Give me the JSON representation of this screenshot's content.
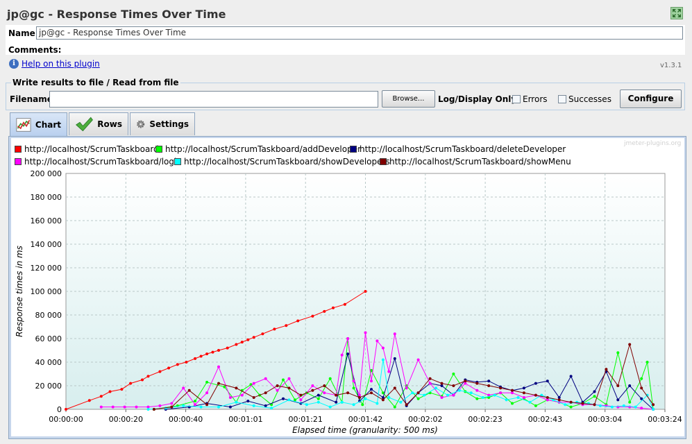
{
  "window": {
    "title": "jp@gc - Response Times Over Time"
  },
  "name": {
    "label": "Name:",
    "value": "jp@gc - Response Times Over Time"
  },
  "comments": {
    "label": "Comments:"
  },
  "help": {
    "link": "Help on this plugin",
    "version": "v1.3.1"
  },
  "file_group": {
    "title": "Write results to file / Read from file",
    "filename_label": "Filename",
    "filename_value": "",
    "browse": "Browse...",
    "log_display_label": "Log/Display Only:",
    "errors_label": "Errors",
    "errors_checked": false,
    "successes_label": "Successes",
    "successes_checked": false,
    "configure": "Configure"
  },
  "tabs": [
    {
      "label": "Chart",
      "icon": "chart-icon",
      "active": true
    },
    {
      "label": "Rows",
      "icon": "checkmark-icon",
      "active": false
    },
    {
      "label": "Settings",
      "icon": "gear-icon",
      "active": false
    }
  ],
  "watermark": "jmeter-plugins.org",
  "chart_data": {
    "type": "line",
    "xlabel": "Elapsed time (granularity: 500 ms)",
    "ylabel": "Response times in ms",
    "x_ticks": [
      "00:00:00",
      "00:00:20",
      "00:00:40",
      "00:01:01",
      "00:01:21",
      "00:01:42",
      "00:02:02",
      "00:02:23",
      "00:02:43",
      "00:03:04",
      "00:03:24"
    ],
    "y_ticks": [
      "0",
      "20 000",
      "40 000",
      "60 000",
      "80 000",
      "100 000",
      "120 000",
      "140 000",
      "160 000",
      "180 000",
      "200 000"
    ],
    "xlim_seconds": [
      0,
      204
    ],
    "ylim": [
      0,
      200000
    ],
    "grid": true,
    "legend_position": "top",
    "series": [
      {
        "name": "http://localhost/ScrumTaskboard/",
        "color": "#ff0000",
        "x": [
          0,
          8,
          12,
          15,
          19,
          22,
          26,
          28,
          32,
          35,
          38,
          41,
          44,
          46,
          48,
          50,
          52,
          55,
          58,
          60,
          62,
          64,
          67,
          71,
          75,
          79,
          84,
          88,
          91,
          95,
          102
        ],
        "y": [
          0,
          7500,
          11000,
          15000,
          17000,
          22000,
          25000,
          28000,
          32000,
          35000,
          38000,
          40000,
          43000,
          45000,
          47000,
          48500,
          50000,
          52000,
          55000,
          57000,
          59000,
          61000,
          64000,
          68000,
          71000,
          75000,
          79000,
          83000,
          86000,
          89000,
          100000
        ]
      },
      {
        "name": "http://localhost/ScrumTaskboard/addDeveloper",
        "color": "#00ff00",
        "x": [
          30,
          38,
          44,
          48,
          54,
          58,
          60,
          63,
          66,
          70,
          74,
          78,
          82,
          86,
          90,
          94,
          96,
          98,
          101,
          104,
          108,
          112,
          116,
          120,
          124,
          128,
          132,
          136,
          140,
          144,
          148,
          152,
          156,
          160,
          164,
          168,
          172,
          176,
          180,
          184,
          188,
          192,
          196,
          198,
          200
        ],
        "y": [
          0,
          3000,
          7000,
          23000,
          19000,
          6000,
          16000,
          21000,
          12000,
          4000,
          25000,
          8000,
          14000,
          9000,
          26000,
          6000,
          60000,
          18000,
          4000,
          33000,
          14000,
          2000,
          20000,
          9000,
          14000,
          11000,
          30000,
          15000,
          9000,
          10000,
          14000,
          5000,
          9000,
          3000,
          8000,
          6000,
          2000,
          5000,
          11000,
          4000,
          48000,
          6000,
          26000,
          40000,
          0
        ]
      },
      {
        "name": "http://localhost/ScrumTaskboard/deleteDeveloper",
        "color": "#000080",
        "x": [
          34,
          42,
          48,
          56,
          62,
          68,
          74,
          80,
          86,
          92,
          96,
          100,
          104,
          108,
          112,
          116,
          120,
          124,
          128,
          132,
          136,
          140,
          144,
          148,
          152,
          156,
          160,
          164,
          168,
          172,
          176,
          180,
          184,
          188,
          192,
          196,
          200
        ],
        "y": [
          0,
          2000,
          5000,
          2000,
          7000,
          3000,
          9000,
          5000,
          12000,
          6000,
          47000,
          7000,
          17000,
          10000,
          43000,
          3000,
          14000,
          22000,
          20000,
          12000,
          25000,
          23000,
          24000,
          19000,
          16000,
          18000,
          22000,
          24000,
          10000,
          28000,
          6000,
          15000,
          32000,
          8000,
          20000,
          9000,
          0
        ]
      },
      {
        "name": "http://localhost/ScrumTaskboard/login",
        "color": "#ff00ff",
        "x": [
          12,
          16,
          20,
          24,
          28,
          32,
          36,
          40,
          44,
          48,
          52,
          56,
          60,
          64,
          68,
          72,
          76,
          80,
          84,
          88,
          92,
          94,
          96,
          98,
          100,
          102,
          104,
          106,
          108,
          110,
          112,
          116,
          120,
          124,
          128,
          132,
          136,
          140,
          144,
          148,
          152,
          156,
          160,
          164,
          168,
          172,
          176,
          180,
          184,
          188,
          192,
          196,
          200
        ],
        "y": [
          2000,
          2000,
          2000,
          2000,
          2000,
          3000,
          5000,
          18000,
          4000,
          14000,
          36000,
          10000,
          12000,
          22000,
          26000,
          16000,
          26000,
          8000,
          20000,
          14000,
          12000,
          46000,
          60000,
          24000,
          12000,
          65000,
          24000,
          58000,
          52000,
          32000,
          64000,
          18000,
          42000,
          22000,
          10000,
          12000,
          22000,
          16000,
          12000,
          14000,
          14000,
          10000,
          12000,
          8000,
          6000,
          6000,
          4000,
          4000,
          3000,
          2000,
          2000,
          1000,
          0
        ]
      },
      {
        "name": "http://localhost/ScrumTaskboard/showDevelopers",
        "color": "#00ffff",
        "x": [
          28,
          34,
          40,
          46,
          52,
          58,
          64,
          70,
          76,
          82,
          86,
          90,
          94,
          98,
          102,
          106,
          108,
          110,
          114,
          118,
          122,
          126,
          130,
          134,
          138,
          142,
          146,
          150,
          154,
          158,
          162,
          166,
          170,
          174,
          178,
          182,
          186,
          190,
          194,
          198,
          200
        ],
        "y": [
          0,
          1000,
          3000,
          2000,
          2000,
          6000,
          3000,
          1000,
          8000,
          4000,
          6000,
          2000,
          6000,
          4000,
          9000,
          5000,
          42000,
          10000,
          6000,
          14000,
          12000,
          18000,
          12000,
          16000,
          14000,
          10000,
          12000,
          8000,
          10000,
          6000,
          12000,
          8000,
          4000,
          6000,
          5000,
          3000,
          2000,
          3000,
          2000,
          12000,
          0
        ]
      },
      {
        "name": "http://localhost/ScrumTaskboard/showMenu",
        "color": "#800000",
        "x": [
          30,
          36,
          42,
          48,
          52,
          58,
          64,
          68,
          72,
          76,
          80,
          84,
          88,
          92,
          96,
          100,
          104,
          108,
          112,
          116,
          120,
          124,
          128,
          132,
          136,
          140,
          144,
          148,
          152,
          156,
          160,
          164,
          168,
          172,
          176,
          180,
          184,
          188,
          192,
          196,
          200
        ],
        "y": [
          0,
          2000,
          16000,
          4000,
          22000,
          18000,
          10000,
          14000,
          20000,
          18000,
          12000,
          16000,
          20000,
          12000,
          14000,
          10000,
          14000,
          8000,
          18000,
          4000,
          14000,
          26000,
          22000,
          20000,
          24000,
          22000,
          20000,
          18000,
          16000,
          14000,
          12000,
          10000,
          8000,
          6000,
          5000,
          4000,
          34000,
          20000,
          55000,
          18000,
          4000
        ]
      }
    ]
  }
}
